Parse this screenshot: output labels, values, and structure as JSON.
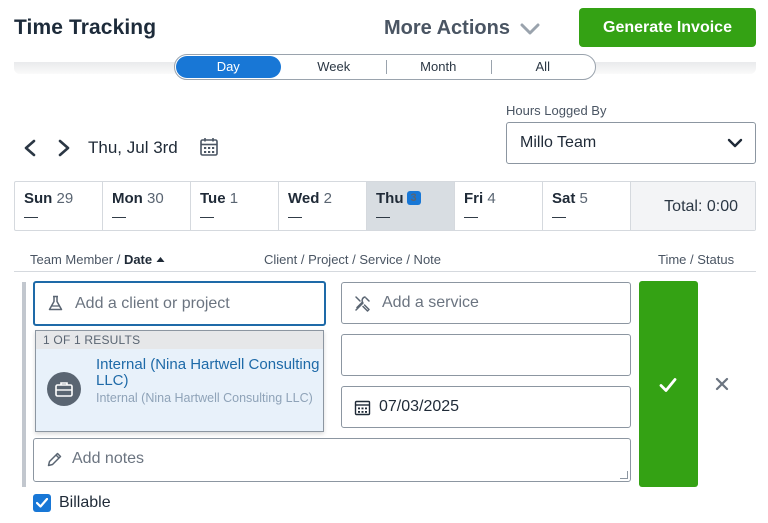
{
  "header": {
    "title": "Time Tracking",
    "more_actions": "More Actions",
    "generate_invoice": "Generate Invoice"
  },
  "view_tabs": [
    {
      "label": "Day",
      "active": true
    },
    {
      "label": "Week",
      "active": false
    },
    {
      "label": "Month",
      "active": false
    },
    {
      "label": "All",
      "active": false
    }
  ],
  "hours_logged_by": {
    "label": "Hours Logged By",
    "value": "Millo Team"
  },
  "date_nav": {
    "current": "Thu, Jul 3rd"
  },
  "week": {
    "days": [
      {
        "name": "Sun",
        "num": "29",
        "hours": "—"
      },
      {
        "name": "Mon",
        "num": "30",
        "hours": "—"
      },
      {
        "name": "Tue",
        "num": "1",
        "hours": "—"
      },
      {
        "name": "Wed",
        "num": "2",
        "hours": "—"
      },
      {
        "name": "Thu",
        "num": "3",
        "hours": "—"
      },
      {
        "name": "Fri",
        "num": "4",
        "hours": "—"
      },
      {
        "name": "Sat",
        "num": "5",
        "hours": "—"
      }
    ],
    "active_index": 4,
    "total": "Total: 0:00"
  },
  "columns": {
    "team_member": "Team Member /",
    "date": "Date",
    "client": "Client / Project / Service / Note",
    "time_status": "Time / Status"
  },
  "entry": {
    "client_placeholder": "Add a client or project",
    "service_placeholder": "Add a service",
    "date_value": "07/03/2025",
    "notes_placeholder": "Add notes",
    "billable_label": "Billable",
    "billable_checked": true
  },
  "dropdown": {
    "results_count": "1 OF 1 RESULTS",
    "items": [
      {
        "name": "Internal (Nina Hartwell Consulting LLC)",
        "sub": "Internal (Nina Hartwell Consulting LLC)"
      }
    ]
  },
  "colors": {
    "accent_blue": "#1877d6",
    "green": "#34a214",
    "text_dark": "#1f2a37"
  }
}
